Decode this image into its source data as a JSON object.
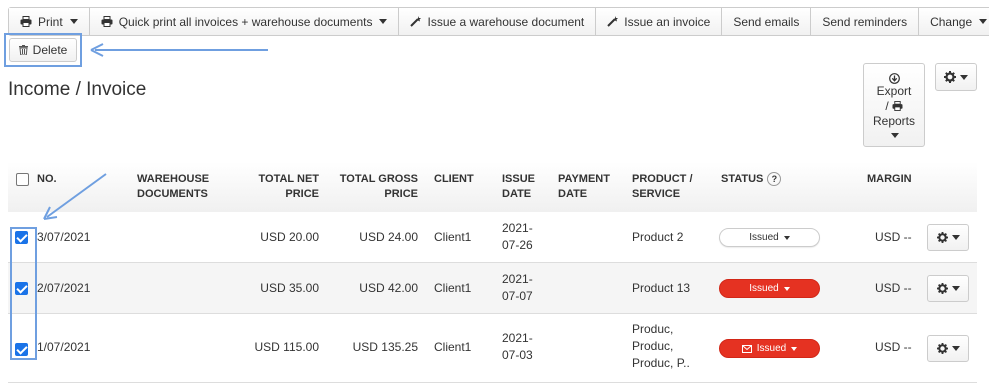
{
  "toolbar": {
    "print": "Print",
    "quick_print": "Quick print all invoices + warehouse documents",
    "issue_warehouse": "Issue a warehouse document",
    "issue_invoice": "Issue an invoice",
    "send_emails": "Send emails",
    "send_reminders": "Send reminders",
    "change": "Change"
  },
  "delete_label": "Delete",
  "page_title": "Income / Invoice",
  "export": {
    "line1": "Export",
    "line2": "/",
    "line3": "Reports"
  },
  "columns": {
    "no": "NO.",
    "warehouse_1": "WAREHOUSE",
    "warehouse_2": "DOCUMENTS",
    "total_net_1": "TOTAL NET",
    "total_net_2": "PRICE",
    "total_gross_1": "TOTAL GROSS",
    "total_gross_2": "PRICE",
    "client": "CLIENT",
    "issue_date_1": "ISSUE",
    "issue_date_2": "DATE",
    "payment_date_1": "PAYMENT",
    "payment_date_2": "DATE",
    "product_1": "PRODUCT /",
    "product_2": "SERVICE",
    "status": "STATUS",
    "status_help": "?",
    "margin": "MARGIN"
  },
  "rows": [
    {
      "checked": true,
      "no": "3/07/2021",
      "net": "USD 20.00",
      "gross": "USD 24.00",
      "client": "Client1",
      "date_1": "2021-",
      "date_2": "07-26",
      "product_1": "Product 2",
      "product_2": "",
      "product_3": "",
      "status": "Issued",
      "status_color": "#ffffff",
      "margin": "USD --"
    },
    {
      "checked": true,
      "no": "2/07/2021",
      "net": "USD 35.00",
      "gross": "USD 42.00",
      "client": "Client1",
      "date_1": "2021-",
      "date_2": "07-07",
      "product_1": "Product 13",
      "product_2": "",
      "product_3": "",
      "status": "Issued",
      "status_color": "#e53222",
      "margin": "USD --"
    },
    {
      "checked": true,
      "no": "1/07/2021",
      "net": "USD 115.00",
      "gross": "USD 135.25",
      "client": "Client1",
      "date_1": "2021-",
      "date_2": "07-03",
      "product_1": "Produc,",
      "product_2": "Produc,",
      "product_3": "Produc, P..",
      "status": "Issued",
      "status_color": "#e53222",
      "margin": "USD --"
    }
  ],
  "annotation_color": "#6f9fe0"
}
